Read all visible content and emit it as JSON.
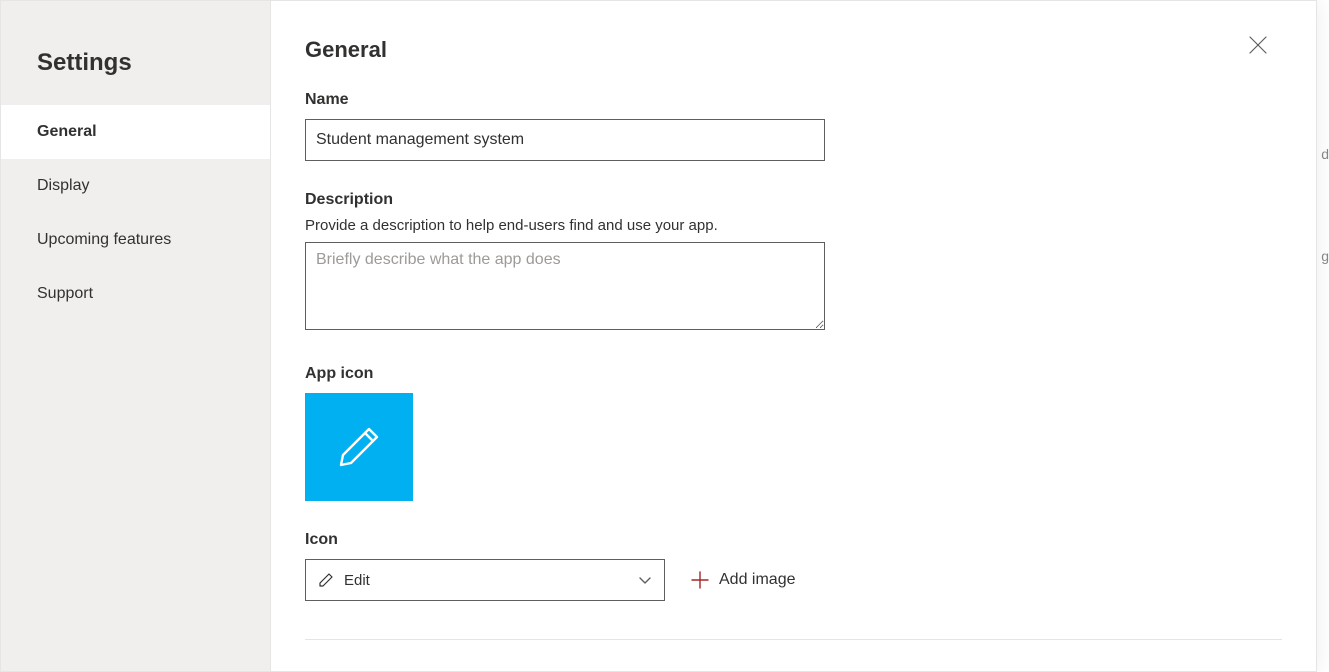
{
  "sidebar": {
    "title": "Settings",
    "items": [
      {
        "label": "General",
        "active": true
      },
      {
        "label": "Display",
        "active": false
      },
      {
        "label": "Upcoming features",
        "active": false
      },
      {
        "label": "Support",
        "active": false
      }
    ]
  },
  "page": {
    "title": "General"
  },
  "name_field": {
    "label": "Name",
    "value": "Student management system"
  },
  "description_field": {
    "label": "Description",
    "help": "Provide a description to help end-users find and use your app.",
    "placeholder": "Briefly describe what the app does",
    "value": ""
  },
  "app_icon": {
    "label": "App icon",
    "color": "#00b0f0"
  },
  "icon_select": {
    "label": "Icon",
    "selected": "Edit"
  },
  "add_image": {
    "label": "Add image"
  }
}
